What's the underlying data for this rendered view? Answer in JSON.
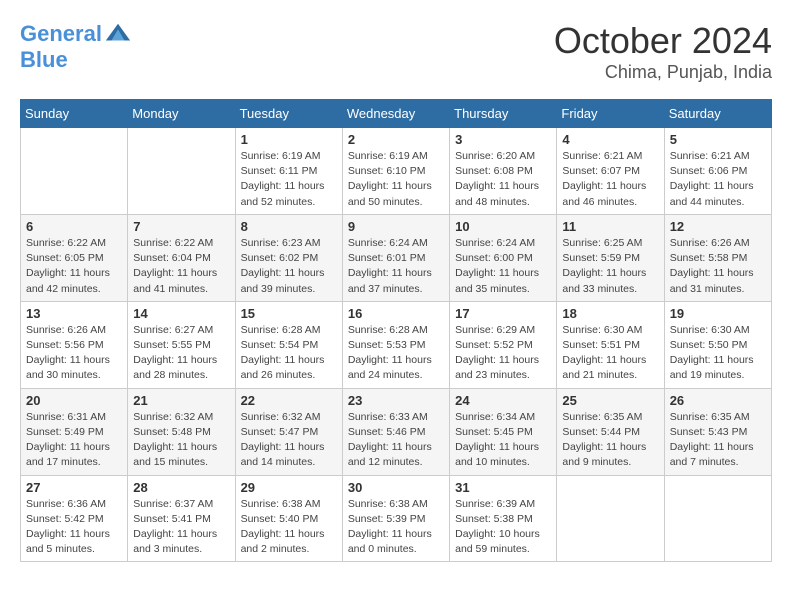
{
  "header": {
    "logo_general": "General",
    "logo_blue": "Blue",
    "month": "October 2024",
    "location": "Chima, Punjab, India"
  },
  "weekdays": [
    "Sunday",
    "Monday",
    "Tuesday",
    "Wednesday",
    "Thursday",
    "Friday",
    "Saturday"
  ],
  "weeks": [
    [
      {
        "day": "",
        "sunrise": "",
        "sunset": "",
        "daylight": ""
      },
      {
        "day": "",
        "sunrise": "",
        "sunset": "",
        "daylight": ""
      },
      {
        "day": "1",
        "sunrise": "Sunrise: 6:19 AM",
        "sunset": "Sunset: 6:11 PM",
        "daylight": "Daylight: 11 hours and 52 minutes."
      },
      {
        "day": "2",
        "sunrise": "Sunrise: 6:19 AM",
        "sunset": "Sunset: 6:10 PM",
        "daylight": "Daylight: 11 hours and 50 minutes."
      },
      {
        "day": "3",
        "sunrise": "Sunrise: 6:20 AM",
        "sunset": "Sunset: 6:08 PM",
        "daylight": "Daylight: 11 hours and 48 minutes."
      },
      {
        "day": "4",
        "sunrise": "Sunrise: 6:21 AM",
        "sunset": "Sunset: 6:07 PM",
        "daylight": "Daylight: 11 hours and 46 minutes."
      },
      {
        "day": "5",
        "sunrise": "Sunrise: 6:21 AM",
        "sunset": "Sunset: 6:06 PM",
        "daylight": "Daylight: 11 hours and 44 minutes."
      }
    ],
    [
      {
        "day": "6",
        "sunrise": "Sunrise: 6:22 AM",
        "sunset": "Sunset: 6:05 PM",
        "daylight": "Daylight: 11 hours and 42 minutes."
      },
      {
        "day": "7",
        "sunrise": "Sunrise: 6:22 AM",
        "sunset": "Sunset: 6:04 PM",
        "daylight": "Daylight: 11 hours and 41 minutes."
      },
      {
        "day": "8",
        "sunrise": "Sunrise: 6:23 AM",
        "sunset": "Sunset: 6:02 PM",
        "daylight": "Daylight: 11 hours and 39 minutes."
      },
      {
        "day": "9",
        "sunrise": "Sunrise: 6:24 AM",
        "sunset": "Sunset: 6:01 PM",
        "daylight": "Daylight: 11 hours and 37 minutes."
      },
      {
        "day": "10",
        "sunrise": "Sunrise: 6:24 AM",
        "sunset": "Sunset: 6:00 PM",
        "daylight": "Daylight: 11 hours and 35 minutes."
      },
      {
        "day": "11",
        "sunrise": "Sunrise: 6:25 AM",
        "sunset": "Sunset: 5:59 PM",
        "daylight": "Daylight: 11 hours and 33 minutes."
      },
      {
        "day": "12",
        "sunrise": "Sunrise: 6:26 AM",
        "sunset": "Sunset: 5:58 PM",
        "daylight": "Daylight: 11 hours and 31 minutes."
      }
    ],
    [
      {
        "day": "13",
        "sunrise": "Sunrise: 6:26 AM",
        "sunset": "Sunset: 5:56 PM",
        "daylight": "Daylight: 11 hours and 30 minutes."
      },
      {
        "day": "14",
        "sunrise": "Sunrise: 6:27 AM",
        "sunset": "Sunset: 5:55 PM",
        "daylight": "Daylight: 11 hours and 28 minutes."
      },
      {
        "day": "15",
        "sunrise": "Sunrise: 6:28 AM",
        "sunset": "Sunset: 5:54 PM",
        "daylight": "Daylight: 11 hours and 26 minutes."
      },
      {
        "day": "16",
        "sunrise": "Sunrise: 6:28 AM",
        "sunset": "Sunset: 5:53 PM",
        "daylight": "Daylight: 11 hours and 24 minutes."
      },
      {
        "day": "17",
        "sunrise": "Sunrise: 6:29 AM",
        "sunset": "Sunset: 5:52 PM",
        "daylight": "Daylight: 11 hours and 23 minutes."
      },
      {
        "day": "18",
        "sunrise": "Sunrise: 6:30 AM",
        "sunset": "Sunset: 5:51 PM",
        "daylight": "Daylight: 11 hours and 21 minutes."
      },
      {
        "day": "19",
        "sunrise": "Sunrise: 6:30 AM",
        "sunset": "Sunset: 5:50 PM",
        "daylight": "Daylight: 11 hours and 19 minutes."
      }
    ],
    [
      {
        "day": "20",
        "sunrise": "Sunrise: 6:31 AM",
        "sunset": "Sunset: 5:49 PM",
        "daylight": "Daylight: 11 hours and 17 minutes."
      },
      {
        "day": "21",
        "sunrise": "Sunrise: 6:32 AM",
        "sunset": "Sunset: 5:48 PM",
        "daylight": "Daylight: 11 hours and 15 minutes."
      },
      {
        "day": "22",
        "sunrise": "Sunrise: 6:32 AM",
        "sunset": "Sunset: 5:47 PM",
        "daylight": "Daylight: 11 hours and 14 minutes."
      },
      {
        "day": "23",
        "sunrise": "Sunrise: 6:33 AM",
        "sunset": "Sunset: 5:46 PM",
        "daylight": "Daylight: 11 hours and 12 minutes."
      },
      {
        "day": "24",
        "sunrise": "Sunrise: 6:34 AM",
        "sunset": "Sunset: 5:45 PM",
        "daylight": "Daylight: 11 hours and 10 minutes."
      },
      {
        "day": "25",
        "sunrise": "Sunrise: 6:35 AM",
        "sunset": "Sunset: 5:44 PM",
        "daylight": "Daylight: 11 hours and 9 minutes."
      },
      {
        "day": "26",
        "sunrise": "Sunrise: 6:35 AM",
        "sunset": "Sunset: 5:43 PM",
        "daylight": "Daylight: 11 hours and 7 minutes."
      }
    ],
    [
      {
        "day": "27",
        "sunrise": "Sunrise: 6:36 AM",
        "sunset": "Sunset: 5:42 PM",
        "daylight": "Daylight: 11 hours and 5 minutes."
      },
      {
        "day": "28",
        "sunrise": "Sunrise: 6:37 AM",
        "sunset": "Sunset: 5:41 PM",
        "daylight": "Daylight: 11 hours and 3 minutes."
      },
      {
        "day": "29",
        "sunrise": "Sunrise: 6:38 AM",
        "sunset": "Sunset: 5:40 PM",
        "daylight": "Daylight: 11 hours and 2 minutes."
      },
      {
        "day": "30",
        "sunrise": "Sunrise: 6:38 AM",
        "sunset": "Sunset: 5:39 PM",
        "daylight": "Daylight: 11 hours and 0 minutes."
      },
      {
        "day": "31",
        "sunrise": "Sunrise: 6:39 AM",
        "sunset": "Sunset: 5:38 PM",
        "daylight": "Daylight: 10 hours and 59 minutes."
      },
      {
        "day": "",
        "sunrise": "",
        "sunset": "",
        "daylight": ""
      },
      {
        "day": "",
        "sunrise": "",
        "sunset": "",
        "daylight": ""
      }
    ]
  ]
}
